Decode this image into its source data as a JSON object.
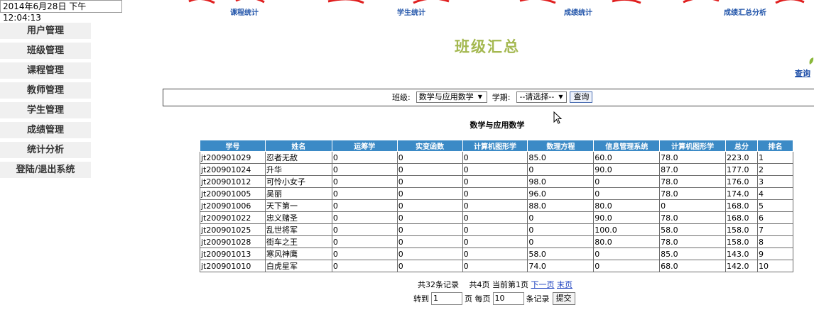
{
  "datetime": "2014年6月28日 下午12:04:13",
  "topnav": [
    "课程统计",
    "学生统计",
    "成绩统计",
    "成绩汇总分析"
  ],
  "sidebar": [
    "用户管理",
    "班级管理",
    "课程管理",
    "教师管理",
    "学生管理",
    "成绩管理",
    "统计分析",
    "登陆/退出系统"
  ],
  "page_title": "班级汇总",
  "query_link": "查询",
  "filter": {
    "class_label": "班级:",
    "class_value": "数学与应用数学",
    "term_label": "学期:",
    "term_value": "--请选择--",
    "query_button": "查询"
  },
  "sub_title": "数学与应用数学",
  "table": {
    "headers": [
      "学号",
      "姓名",
      "运筹学",
      "实变函数",
      "计算机图形学",
      "数理方程",
      "信息管理系统",
      "计算机图形学",
      "总分",
      "排名"
    ],
    "rows": [
      [
        "jt200901029",
        "忍者无敌",
        "0",
        "0",
        "0",
        "85.0",
        "60.0",
        "78.0",
        "223.0",
        "1"
      ],
      [
        "jt200901024",
        "升华",
        "0",
        "0",
        "0",
        "0",
        "90.0",
        "87.0",
        "177.0",
        "2"
      ],
      [
        "jt200901012",
        "可怜小女子",
        "0",
        "0",
        "0",
        "98.0",
        "0",
        "78.0",
        "176.0",
        "3"
      ],
      [
        "jt200901005",
        "吴丽",
        "0",
        "0",
        "0",
        "96.0",
        "0",
        "78.0",
        "174.0",
        "4"
      ],
      [
        "jt200901006",
        "天下第一",
        "0",
        "0",
        "0",
        "88.0",
        "80.0",
        "0",
        "168.0",
        "5"
      ],
      [
        "jt200901022",
        "忠义赌圣",
        "0",
        "0",
        "0",
        "0",
        "90.0",
        "78.0",
        "168.0",
        "6"
      ],
      [
        "jt200901025",
        "乱世将军",
        "0",
        "0",
        "0",
        "0",
        "100.0",
        "58.0",
        "158.0",
        "7"
      ],
      [
        "jt200901028",
        "街车之王",
        "0",
        "0",
        "0",
        "0",
        "80.0",
        "78.0",
        "158.0",
        "8"
      ],
      [
        "jt200901013",
        "寒风神鹰",
        "0",
        "0",
        "0",
        "58.0",
        "0",
        "85.0",
        "143.0",
        "9"
      ],
      [
        "jt200901010",
        "白虎星军",
        "0",
        "0",
        "0",
        "74.0",
        "0",
        "68.0",
        "142.0",
        "10"
      ]
    ]
  },
  "pager": {
    "summary": "共32条记录　 共4页 当前第1页",
    "next": "下一页",
    "last": "末页",
    "goto_label": "转到",
    "goto_value": "1",
    "page_size_label": "页 每页",
    "page_size_value": "10",
    "records_label": "条记录",
    "submit": "提交"
  },
  "colors": {
    "header_bg": "#3b8ac6",
    "title": "#a4b850",
    "nav_link": "#2255aa",
    "banner_red": "#e02020"
  }
}
